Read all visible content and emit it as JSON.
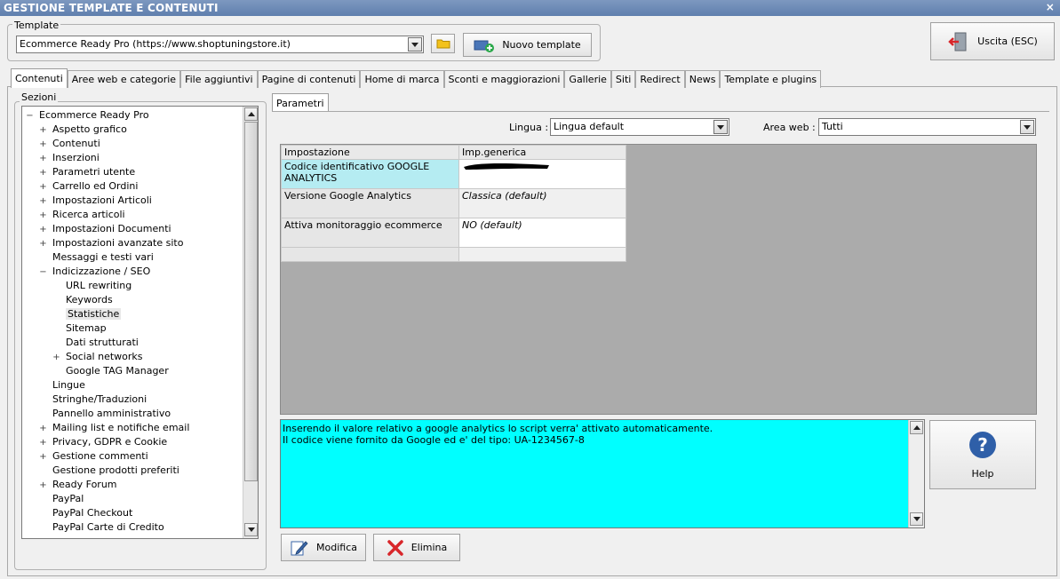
{
  "window": {
    "title": "GESTIONE TEMPLATE E CONTENUTI",
    "close_glyph": "×"
  },
  "template_group": {
    "label": "Template",
    "selected": "Ecommerce Ready Pro (https://www.shoptuningstore.it)",
    "new_button_label": "Nuovo template"
  },
  "exit_button_label": "Uscita (ESC)",
  "tabs": [
    {
      "label": "Contenuti",
      "active": true
    },
    {
      "label": "Aree web e categorie"
    },
    {
      "label": "File aggiuntivi"
    },
    {
      "label": "Pagine di contenuti"
    },
    {
      "label": "Home di marca"
    },
    {
      "label": "Sconti e maggiorazioni"
    },
    {
      "label": "Gallerie"
    },
    {
      "label": "Siti"
    },
    {
      "label": "Redirect"
    },
    {
      "label": "News"
    },
    {
      "label": "Template e plugins"
    }
  ],
  "sections": {
    "label": "Sezioni",
    "items": [
      {
        "label": "Ecommerce Ready Pro",
        "level": 0,
        "expander": "−"
      },
      {
        "label": "Aspetto grafico",
        "level": 1,
        "expander": "+"
      },
      {
        "label": "Contenuti",
        "level": 1,
        "expander": "+"
      },
      {
        "label": "Inserzioni",
        "level": 1,
        "expander": "+"
      },
      {
        "label": "Parametri utente",
        "level": 1,
        "expander": "+"
      },
      {
        "label": "Carrello ed Ordini",
        "level": 1,
        "expander": "+"
      },
      {
        "label": "Impostazioni Articoli",
        "level": 1,
        "expander": "+"
      },
      {
        "label": "Ricerca articoli",
        "level": 1,
        "expander": "+"
      },
      {
        "label": "Impostazioni Documenti",
        "level": 1,
        "expander": "+"
      },
      {
        "label": "Impostazioni avanzate sito",
        "level": 1,
        "expander": "+"
      },
      {
        "label": "Messaggi e testi vari",
        "level": 1,
        "expander": ""
      },
      {
        "label": "Indicizzazione / SEO",
        "level": 1,
        "expander": "−"
      },
      {
        "label": "URL rewriting",
        "level": 2,
        "expander": ""
      },
      {
        "label": "Keywords",
        "level": 2,
        "expander": ""
      },
      {
        "label": "Statistiche",
        "level": 2,
        "expander": "",
        "selected": true
      },
      {
        "label": "Sitemap",
        "level": 2,
        "expander": ""
      },
      {
        "label": "Dati strutturati",
        "level": 2,
        "expander": ""
      },
      {
        "label": "Social networks",
        "level": 2,
        "expander": "+"
      },
      {
        "label": "Google TAG Manager",
        "level": 2,
        "expander": ""
      },
      {
        "label": "Lingue",
        "level": 1,
        "expander": ""
      },
      {
        "label": "Stringhe/Traduzioni",
        "level": 1,
        "expander": ""
      },
      {
        "label": "Pannello amministrativo",
        "level": 1,
        "expander": ""
      },
      {
        "label": "Mailing list e notifiche email",
        "level": 1,
        "expander": "+"
      },
      {
        "label": "Privacy, GDPR e Cookie",
        "level": 1,
        "expander": "+"
      },
      {
        "label": "Gestione commenti",
        "level": 1,
        "expander": "+"
      },
      {
        "label": "Gestione prodotti preferiti",
        "level": 1,
        "expander": ""
      },
      {
        "label": "Ready Forum",
        "level": 1,
        "expander": "+"
      },
      {
        "label": "PayPal",
        "level": 1,
        "expander": ""
      },
      {
        "label": "PayPal Checkout",
        "level": 1,
        "expander": ""
      },
      {
        "label": "PayPal Carte di Credito",
        "level": 1,
        "expander": ""
      }
    ],
    "scroll_position": 0.62
  },
  "params_tab": {
    "label": "Parametri"
  },
  "filters": {
    "lingua_label": "Lingua :",
    "lingua_value": "Lingua default",
    "area_label": "Area web :",
    "area_value": "Tutti"
  },
  "grid": {
    "headers": [
      "Impostazione",
      "Imp.generica"
    ],
    "rows": [
      {
        "key": "Codice identificativo GOOGLE ANALYTICS",
        "value": "",
        "redacted": true
      },
      {
        "key": "Versione Google Analytics",
        "value": "Classica (default)"
      },
      {
        "key": "Attiva monitoraggio ecommerce",
        "value": "NO (default)"
      }
    ]
  },
  "info_text": {
    "line1": "Inserendo il valore relativo a google analytics lo script verra' attivato automaticamente.",
    "line2": "Il codice viene fornito da Google ed e' del tipo: UA-1234567-8"
  },
  "help_button_label": "Help",
  "actions": {
    "modify_label": "Modifica",
    "delete_label": "Elimina"
  },
  "colors": {
    "info_bg": "#00ffff",
    "selected_key_bg": "#b5ecf2",
    "help_blue": "#2f5fa8",
    "delete_red": "#d8262a"
  }
}
